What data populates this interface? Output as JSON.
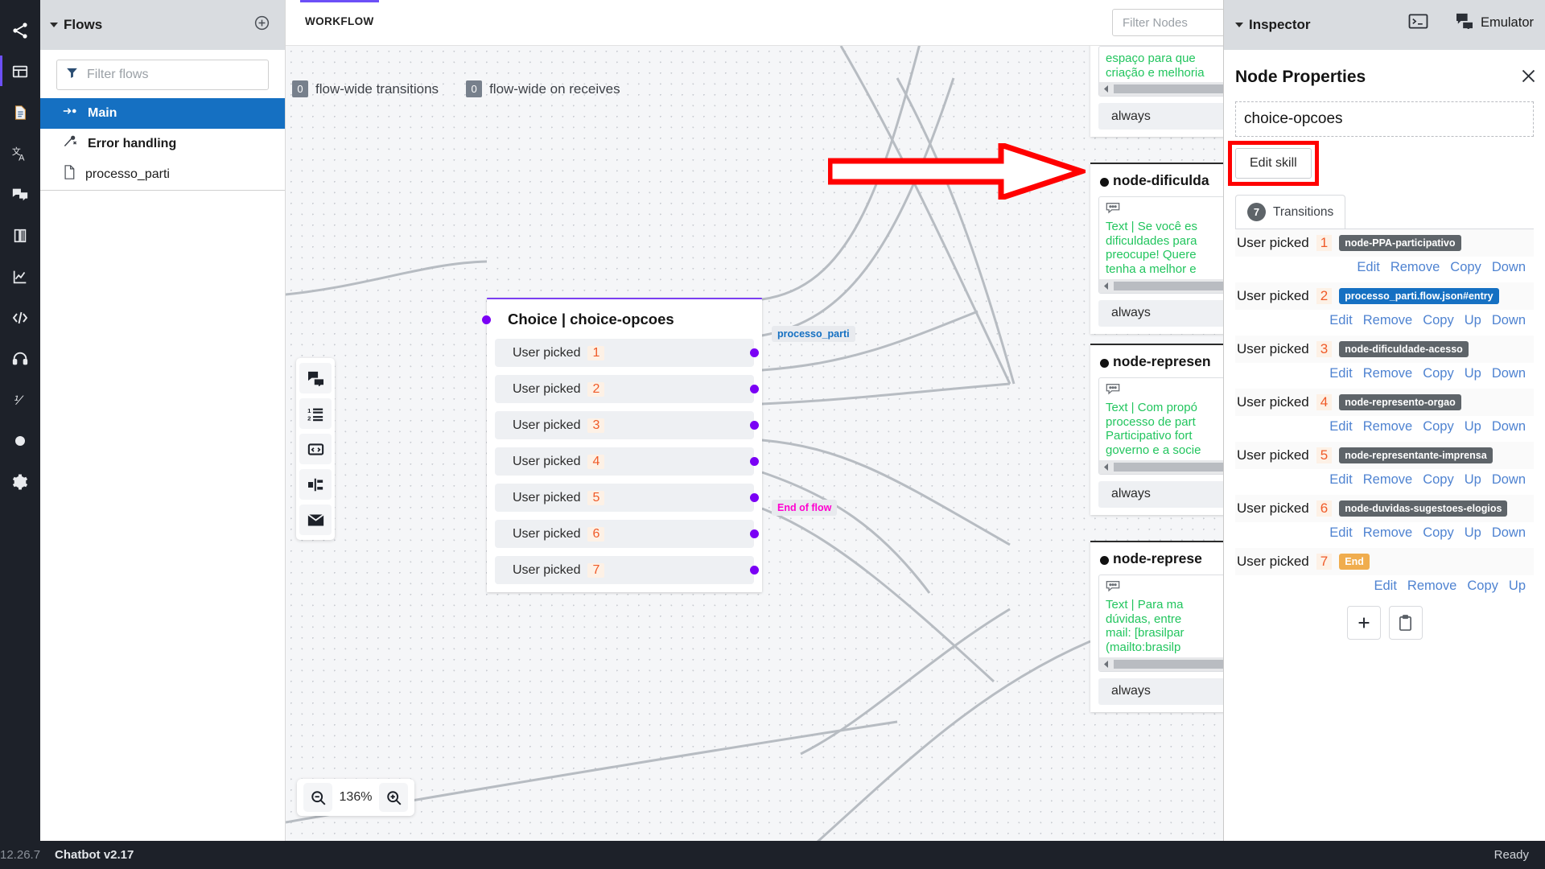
{
  "app": {
    "version_code": "12.26.7",
    "name": "Chatbot v2.17",
    "status": "Ready"
  },
  "header": {
    "terminal_icon": "terminal-icon",
    "emulator_icon": "emulator-chat-icon",
    "emulator_label": "Emulator"
  },
  "rail": {
    "items": [
      {
        "icon": "share-nodes-icon",
        "name": "share-nodes"
      },
      {
        "icon": "layout-panel-icon",
        "name": "layout-panel"
      },
      {
        "icon": "document-icon",
        "name": "document"
      },
      {
        "icon": "translate-icon",
        "name": "translate"
      },
      {
        "icon": "chat-bubbles-icon",
        "name": "chat-bubbles"
      },
      {
        "icon": "book-icon",
        "name": "book"
      },
      {
        "icon": "analytics-icon",
        "name": "analytics"
      },
      {
        "icon": "code-icon",
        "name": "code"
      },
      {
        "icon": "headset-icon",
        "name": "headset"
      },
      {
        "icon": "variable-icon",
        "name": "variable"
      },
      {
        "icon": "circle-icon",
        "name": "circle"
      },
      {
        "icon": "gear-icon",
        "name": "settings"
      }
    ]
  },
  "flows": {
    "title": "Flows",
    "add_icon": "plus-circle-icon",
    "filter_placeholder": "Filter flows",
    "filter_value": "",
    "filter_icon": "funnel-icon",
    "items": [
      {
        "label": "Main",
        "icon": "start-flow-icon",
        "selected": true
      },
      {
        "label": "Error handling",
        "icon": "error-branch-icon",
        "selected": false
      },
      {
        "label": "processo_parti",
        "icon": "file-icon",
        "selected": false
      }
    ]
  },
  "workflow": {
    "tab_label": "WORKFLOW",
    "filter_nodes_placeholder": "Filter Nodes",
    "filter_nodes_value": "",
    "undo_icon": "undo-icon",
    "redo_icon": "redo-icon",
    "flow_wide": [
      {
        "count": "0",
        "label": "flow-wide transitions"
      },
      {
        "count": "0",
        "label": "flow-wide on receives"
      }
    ],
    "mini_tools": [
      {
        "name": "say-node-tool",
        "icon": "chat-bubbles-icon"
      },
      {
        "name": "choice-node-tool",
        "icon": "numbered-list-icon"
      },
      {
        "name": "code-node-tool",
        "icon": "code-block-icon"
      },
      {
        "name": "split-node-tool",
        "icon": "split-icon"
      },
      {
        "name": "email-node-tool",
        "icon": "envelope-icon"
      }
    ],
    "zoom": {
      "level": "136%",
      "zoom_out_icon": "zoom-out-icon",
      "zoom_in_icon": "zoom-in-icon"
    },
    "choice_node": {
      "title": "Choice | choice-opcoes",
      "rows": [
        {
          "label": "User picked",
          "index": "1",
          "chip": ""
        },
        {
          "label": "User picked",
          "index": "2",
          "chip": "processo_parti"
        },
        {
          "label": "User picked",
          "index": "3",
          "chip": ""
        },
        {
          "label": "User picked",
          "index": "4",
          "chip": ""
        },
        {
          "label": "User picked",
          "index": "5",
          "chip": ""
        },
        {
          "label": "User picked",
          "index": "6",
          "chip": ""
        },
        {
          "label": "User picked",
          "index": "7",
          "chip": "End of flow"
        }
      ]
    },
    "edge_nodes": [
      {
        "title_partial": "espaço para que",
        "title2_partial": "criação e melhoria",
        "always": "always"
      },
      {
        "title": "node-dificuldade-acesso",
        "title_clipped": "node-dificulda",
        "lines": [
          "Text | Se você es",
          "dificuldades para",
          "preocupe! Quere",
          "tenha a melhor e"
        ],
        "always": "always"
      },
      {
        "title_clipped": "node-represen",
        "lines": [
          "Text | Com propó",
          "processo de part",
          "Participativo fort",
          "governo e a socie"
        ],
        "always": "always"
      },
      {
        "title_clipped": "node-represe",
        "lines": [
          "Text | Para ma",
          "dúvidas, entre",
          "mail: [brasilpar",
          "(mailto:brasilp"
        ],
        "always": "always"
      }
    ]
  },
  "inspector": {
    "panel_title": "Inspector",
    "heading": "Node Properties",
    "close_icon": "close-icon",
    "node_name": "choice-opcoes",
    "edit_skill_label": "Edit skill",
    "transitions_tab": {
      "count": "7",
      "label": "Transitions"
    },
    "transitions": [
      {
        "label": "User picked",
        "index": "1",
        "target": "node-PPA-participativo",
        "target_style": "grey",
        "actions": [
          "Edit",
          "Remove",
          "Copy",
          "Down"
        ]
      },
      {
        "label": "User picked",
        "index": "2",
        "target": "processo_parti.flow.json#entry",
        "target_style": "blue",
        "actions": [
          "Edit",
          "Remove",
          "Copy",
          "Up",
          "Down"
        ]
      },
      {
        "label": "User picked",
        "index": "3",
        "target": "node-dificuldade-acesso",
        "target_style": "grey",
        "actions": [
          "Edit",
          "Remove",
          "Copy",
          "Up",
          "Down"
        ]
      },
      {
        "label": "User picked",
        "index": "4",
        "target": "node-represento-orgao",
        "target_style": "grey",
        "actions": [
          "Edit",
          "Remove",
          "Copy",
          "Up",
          "Down"
        ]
      },
      {
        "label": "User picked",
        "index": "5",
        "target": "node-representante-imprensa",
        "target_style": "grey",
        "actions": [
          "Edit",
          "Remove",
          "Copy",
          "Up",
          "Down"
        ]
      },
      {
        "label": "User picked",
        "index": "6",
        "target": "node-duvidas-sugestoes-elogios",
        "target_style": "grey",
        "actions": [
          "Edit",
          "Remove",
          "Copy",
          "Up",
          "Down"
        ]
      },
      {
        "label": "User picked",
        "index": "7",
        "target": "End",
        "target_style": "orange",
        "actions": [
          "Edit",
          "Remove",
          "Copy",
          "Up"
        ]
      }
    ],
    "add_transition_icon": "plus-icon",
    "paste_transition_icon": "clipboard-icon"
  },
  "annotation": {
    "type": "red-arrow",
    "color": "#ff0000",
    "points_to": "Edit skill"
  },
  "colors": {
    "accent_purple": "#7b3ff2",
    "selected_blue": "#1570c2",
    "rail_dark": "#1d2129",
    "node_text_green": "#22c55e",
    "index_orange": "#f05a28",
    "annotation_red": "#ff0000"
  }
}
